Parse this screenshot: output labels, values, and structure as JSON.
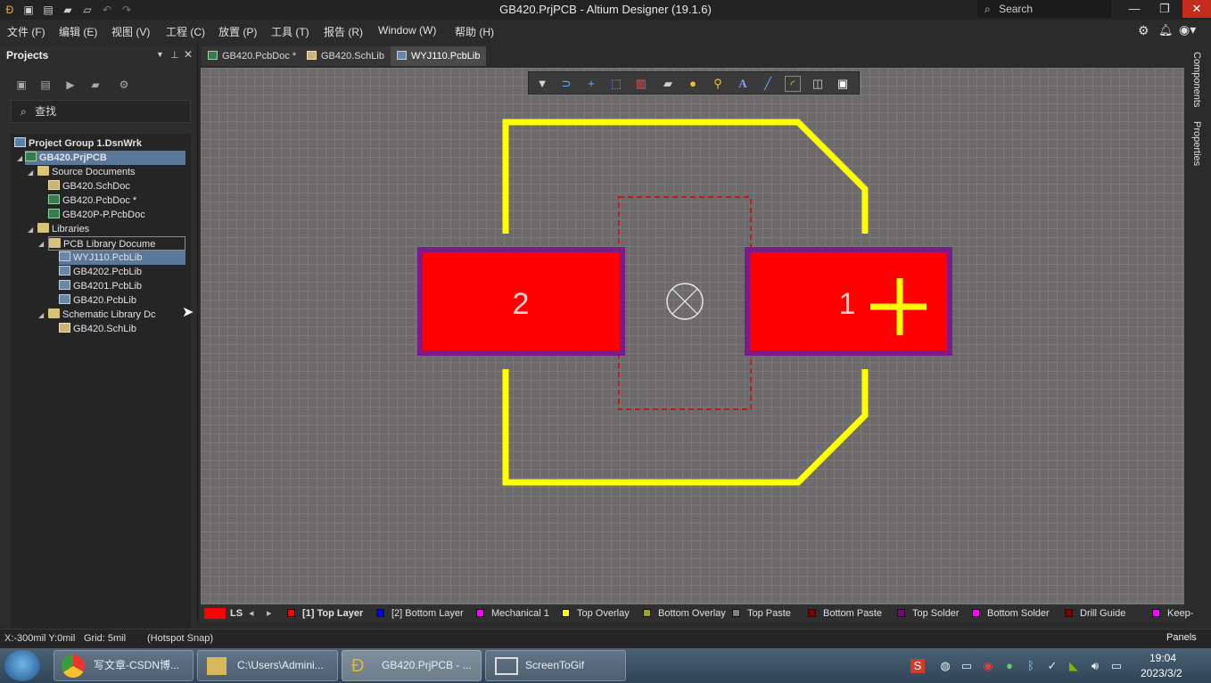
{
  "window": {
    "title": "GB420.PrjPCB - Altium Designer (19.1.6)",
    "search_placeholder": "Search"
  },
  "menu": [
    "文件 (F)",
    "编辑 (E)",
    "视图 (V)",
    "工程 (C)",
    "放置 (P)",
    "工具 (T)",
    "报告 (R)",
    "Window (W)",
    "帮助 (H)"
  ],
  "projects_panel": {
    "title": "Projects",
    "search_placeholder": "查找",
    "tree": [
      {
        "label": "Project Group 1.DsnWrk"
      },
      {
        "label": "GB420.PrjPCB"
      },
      {
        "label": "Source Documents"
      },
      {
        "label": "GB420.SchDoc"
      },
      {
        "label": "GB420.PcbDoc *"
      },
      {
        "label": "GB420P-P.PcbDoc"
      },
      {
        "label": "Libraries"
      },
      {
        "label": "PCB Library Docume"
      },
      {
        "label": "WYJ110.PcbLib"
      },
      {
        "label": "GB4202.PcbLib"
      },
      {
        "label": "GB4201.PcbLib"
      },
      {
        "label": "GB420.PcbLib"
      },
      {
        "label": "Schematic Library Dc"
      },
      {
        "label": "GB420.SchLib"
      }
    ]
  },
  "tabs": [
    {
      "label": "GB420.PcbDoc *"
    },
    {
      "label": "GB420.SchLib"
    },
    {
      "label": "WYJ110.PcbLib",
      "active": true
    }
  ],
  "canvas": {
    "pad_left_number": "2",
    "pad_right_number": "1",
    "colors": {
      "pad": "#ff0000",
      "solder_mask": "#7b1a8a",
      "overlay": "#ffff00",
      "courtyard": "#e00000"
    }
  },
  "right_panels": [
    "Components",
    "Properties"
  ],
  "layers": {
    "current": "LS",
    "items": [
      {
        "label": "[1] Top Layer",
        "color": "#ff0000",
        "active": true
      },
      {
        "label": "[2] Bottom Layer",
        "color": "#0000ff"
      },
      {
        "label": "Mechanical 1",
        "color": "#ff00ff"
      },
      {
        "label": "Top Overlay",
        "color": "#ffff00"
      },
      {
        "label": "Bottom Overlay",
        "color": "#9e9e3a"
      },
      {
        "label": "Top Paste",
        "color": "#808080"
      },
      {
        "label": "Bottom Paste",
        "color": "#800000"
      },
      {
        "label": "Top Solder",
        "color": "#800080"
      },
      {
        "label": "Bottom Solder",
        "color": "#ff00ff"
      },
      {
        "label": "Drill Guide",
        "color": "#800000"
      },
      {
        "label": "Keep-",
        "color": "#ff00ff"
      }
    ]
  },
  "status": {
    "coords": "X:-300mil Y:0mil",
    "grid": "Grid: 5mil",
    "snap": "(Hotspot Snap)",
    "panels_button": "Panels"
  },
  "taskbar": {
    "items": [
      "写文章-CSDN博...",
      "C:\\Users\\Admini...",
      "GB420.PrjPCB - ...",
      "ScreenToGif"
    ],
    "time": "19:04",
    "date": "2023/3/2"
  }
}
